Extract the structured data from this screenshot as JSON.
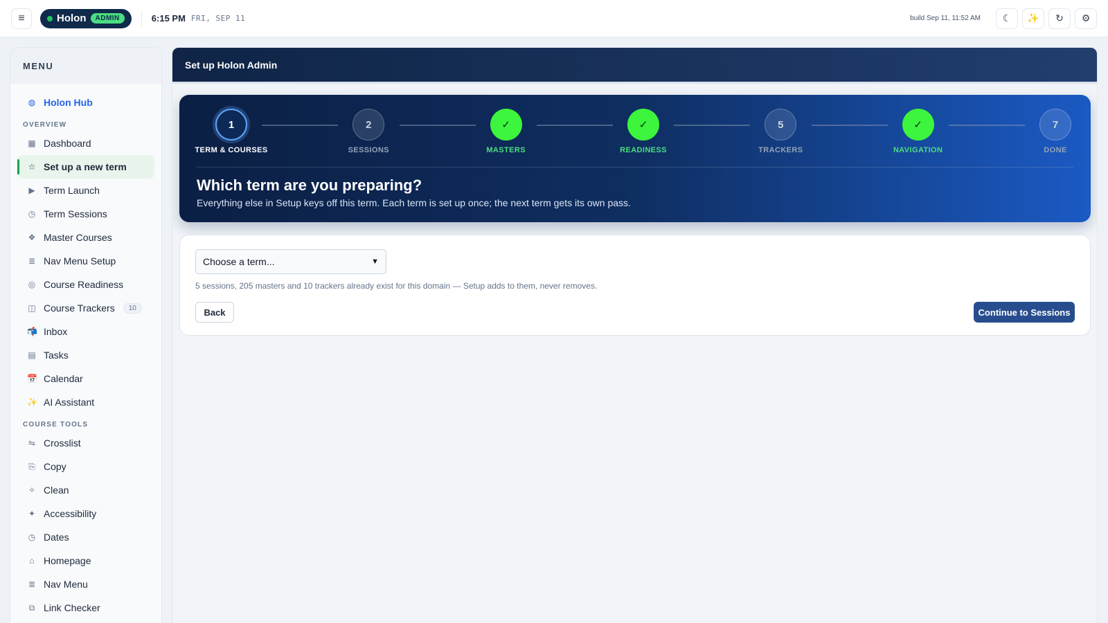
{
  "topbar": {
    "brand": "Holon",
    "badge": "ADMIN",
    "time": "6:15 PM",
    "date": "FRI, SEP 11",
    "build": "build Sep 11, 11:52 AM",
    "icons": [
      "moon-icon",
      "sparkles-icon",
      "refresh-icon",
      "gear-icon"
    ]
  },
  "sidebar": {
    "title": "MENU",
    "hub": "Holon Hub",
    "sections": [
      {
        "label": "OVERVIEW",
        "items": [
          {
            "label": "Dashboard",
            "icon": "▦"
          },
          {
            "label": "Set up a new term",
            "icon": "☆",
            "active": true
          },
          {
            "label": "Term Launch",
            "icon": "▶"
          },
          {
            "label": "Term Sessions",
            "icon": "◷"
          },
          {
            "label": "Master Courses",
            "icon": "❖"
          },
          {
            "label": "Nav Menu Setup",
            "icon": "≣"
          },
          {
            "label": "Course Readiness",
            "icon": "◎"
          },
          {
            "label": "Course Trackers",
            "icon": "◫",
            "count": "10"
          },
          {
            "label": "Inbox",
            "icon": "📬"
          },
          {
            "label": "Tasks",
            "icon": "▤"
          },
          {
            "label": "Calendar",
            "icon": "📅"
          },
          {
            "label": "AI Assistant",
            "icon": "✨"
          }
        ]
      },
      {
        "label": "COURSE TOOLS",
        "items": [
          {
            "label": "Crosslist",
            "icon": "⇋"
          },
          {
            "label": "Copy",
            "icon": "⎘"
          },
          {
            "label": "Clean",
            "icon": "✧"
          },
          {
            "label": "Accessibility",
            "icon": "✦"
          },
          {
            "label": "Dates",
            "icon": "◷"
          },
          {
            "label": "Homepage",
            "icon": "⌂"
          },
          {
            "label": "Nav Menu",
            "icon": "≣"
          },
          {
            "label": "Link Checker",
            "icon": "⧉"
          }
        ]
      }
    ]
  },
  "main": {
    "header": "Set up Holon Admin",
    "steps": [
      {
        "marker": "1",
        "label": "TERM & COURSES",
        "state": "current"
      },
      {
        "marker": "2",
        "label": "SESSIONS",
        "state": "pending"
      },
      {
        "marker": "✓",
        "label": "MASTERS",
        "state": "done"
      },
      {
        "marker": "✓",
        "label": "READINESS",
        "state": "done"
      },
      {
        "marker": "5",
        "label": "TRACKERS",
        "state": "pending"
      },
      {
        "marker": "✓",
        "label": "NAVIGATION",
        "state": "done"
      },
      {
        "marker": "7",
        "label": "DONE",
        "state": "pending"
      }
    ],
    "title": "Which term are you preparing?",
    "subtitle": "Everything else in Setup keys off this term. Each term is set up once; the next term gets its own pass.",
    "select_value": "Choose a term...",
    "info": "5 sessions, 205 masters and 10 trackers already exist for this domain — Setup adds to them, never removes.",
    "back_label": "Back",
    "continue_label": "Continue to Sessions"
  }
}
